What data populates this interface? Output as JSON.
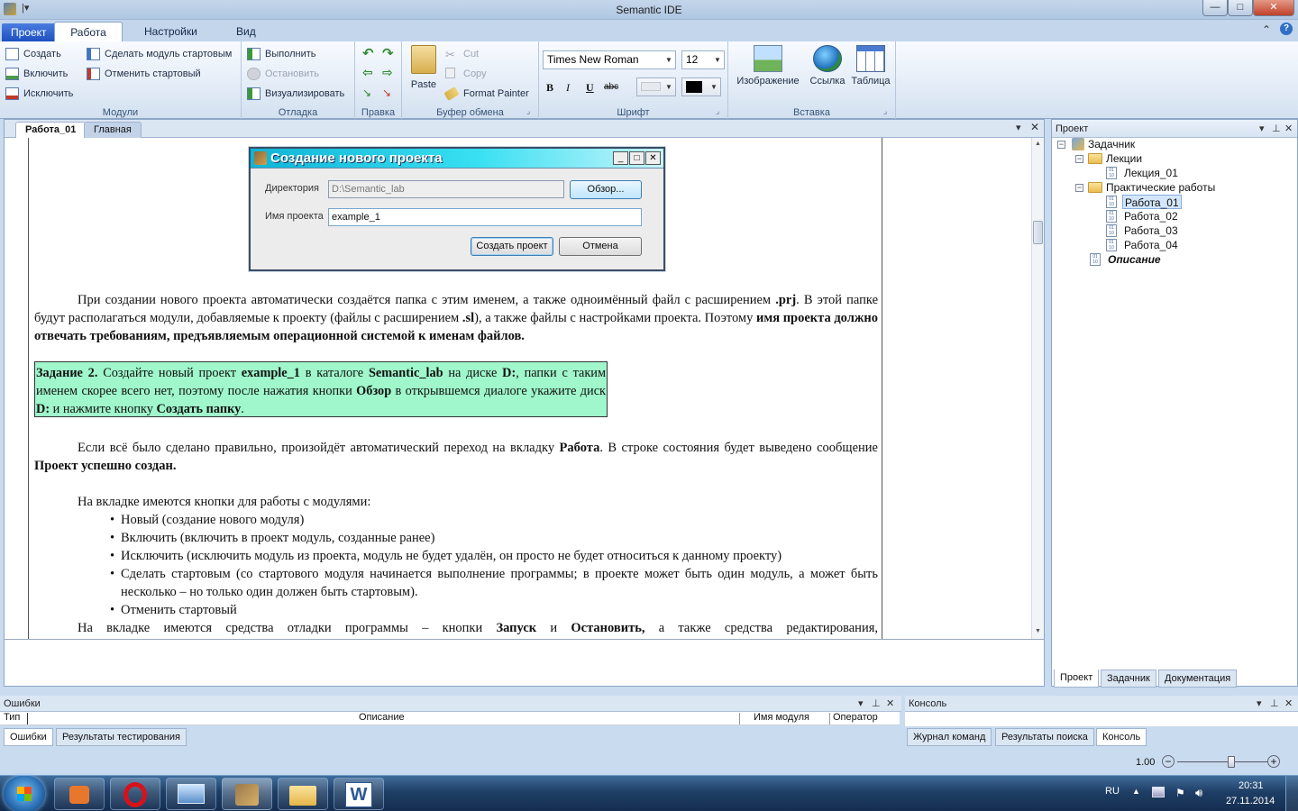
{
  "window": {
    "title": "Semantic IDE",
    "btn_min": "—",
    "btn_max": "□",
    "btn_close": "✕"
  },
  "ribbon_tabs": [
    "Проект",
    "Работа",
    "Настройки",
    "Вид"
  ],
  "ribbon": {
    "modules": {
      "label": "Модули",
      "create": "Создать",
      "include": "Включить",
      "exclude": "Исключить",
      "make_start": "Сделать модуль стартовым",
      "cancel_start": "Отменить стартовый"
    },
    "debug": {
      "label": "Отладка",
      "run": "Выполнить",
      "stop": "Остановить",
      "visualize": "Визуализировать"
    },
    "edit": {
      "label": "Правка"
    },
    "clipboard": {
      "label": "Буфер обмена",
      "paste": "Paste",
      "cut": "Cut",
      "copy": "Copy",
      "format_painter": "Format Painter"
    },
    "font": {
      "label": "Шрифт",
      "family": "Times New Roman",
      "size": "12",
      "bold": "B",
      "italic": "I",
      "underline": "U",
      "strike": "abc"
    },
    "insert": {
      "label": "Вставка",
      "image": "Изображение",
      "link": "Ссылка",
      "table": "Таблица"
    }
  },
  "doc_tabs": [
    "Работа_01",
    "Главная"
  ],
  "dialog": {
    "title": "Создание нового проекта",
    "dir_label": "Директория",
    "dir_value": "D:\\Semantic_lab",
    "browse": "Обзор...",
    "name_label": "Имя проекта",
    "name_value": "example_1",
    "create": "Создать проект",
    "cancel": "Отмена"
  },
  "doc": {
    "p1": {
      "a": "При создании нового проекта автоматически создаётся папка с этим именем, а также одноимённый файл с расширением ",
      "b": ".prj",
      "c": ". В этой папке будут располагаться модули, добавляемые к проекту (файлы с расширением ",
      "d": ".sl",
      "e": "), а также файлы с настройками проекта. Поэтому ",
      "f": "имя проекта должно отвечать требованиям, предъявляемым операционной системой к именам файлов."
    },
    "task": {
      "a": "Задание 2.",
      "b": " Создайте новый проект ",
      "c": "example_1",
      "d": " в каталоге ",
      "e": "Semantic_lab",
      "f": " на диске ",
      "g": "D:",
      "h": ", папки с таким именем скорее всего нет, поэтому после нажатия кнопки ",
      "i": "Обзор",
      "j": " в открывшемся диалоге укажите диск ",
      "k": "D:",
      "l": " и нажмите кнопку ",
      "m": "Создать папку",
      "n": "."
    },
    "p2": {
      "a": "Если всё было сделано правильно, произойдёт автоматический переход на вкладку ",
      "b": "Работа",
      "c": ". В строке состояния будет выведено сообщение ",
      "d": "Проект успешно создан."
    },
    "p3": "На вкладке имеются кнопки для работы с модулями:",
    "bullets": [
      "Новый (создание нового модуля)",
      "Включить (включить в проект модуль, созданные ранее)",
      "Исключить (исключить модуль из проекта, модуль не будет удалён, он просто не будет относиться к данному проекту)",
      "Сделать стартовым (со стартового модуля начинается выполнение программы; в проекте может быть один модуль, а может быть несколько – но только один должен быть стартовым).",
      "Отменить стартовый"
    ],
    "p4": {
      "a": "На вкладке имеются средства отладки программы – кнопки ",
      "b": "Запуск",
      "c": " и ",
      "d": "Остановить,",
      "e": " а также средства редактирования,"
    }
  },
  "project_panel": {
    "title": "Проект",
    "root": "Задачник",
    "lectures": "Лекции",
    "lecture_01": "Лекция_01",
    "practicals": "Практические работы",
    "works": [
      "Работа_01",
      "Работа_02",
      "Работа_03",
      "Работа_04"
    ],
    "description": "Описание",
    "tabs": [
      "Проект",
      "Задачник",
      "Документация"
    ]
  },
  "errors_panel": {
    "title": "Ошибки",
    "col_type": "Тип",
    "col_desc": "Описание",
    "col_module": "Имя модуля",
    "col_operator": "Оператор",
    "tabs": [
      "Ошибки",
      "Результаты тестирования"
    ]
  },
  "console_panel": {
    "title": "Консоль",
    "tabs": [
      "Журнал команд",
      "Результаты поиска",
      "Консоль"
    ]
  },
  "status": {
    "zoom": "1.00",
    "zoom_level": 0.6
  },
  "taskbar": {
    "lang": "RU",
    "time": "20:31",
    "date": "27.11.2014"
  },
  "colors": {
    "accent": "#1d4fc0",
    "task_bg": "#9ff7cb",
    "dialog_title": "#0fb4d6"
  }
}
